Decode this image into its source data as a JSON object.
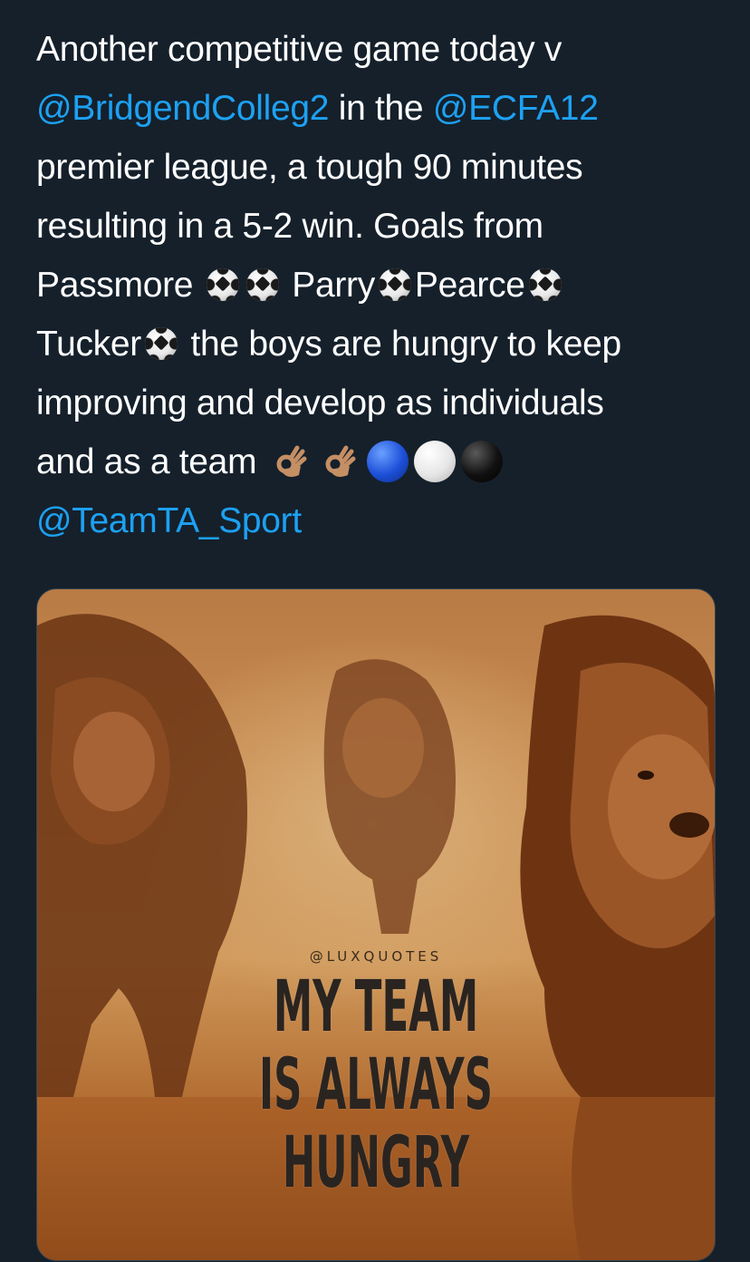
{
  "tweet": {
    "line1": "Another competitive game today v",
    "mention_college": "@BridgendColleg2",
    "in_the": " in the ",
    "mention_ecfa": "@ECFA12",
    "line3": "premier league, a tough 90 minutes",
    "line4": "resulting in a 5-2 win. Goals from",
    "scorer1": "Passmore ",
    "scorer2": " Parry",
    "scorer3": "Pearce",
    "scorer4": "Tucker",
    "line6_rest": "  the boys are hungry to keep",
    "line7": "improving and develop as individuals",
    "line8": "and as a team ",
    "mention_team": "@TeamTA_Sport"
  },
  "emoji": {
    "ball": "soccer-ball-icon",
    "ok_hand": "ok-hand-icon",
    "circles": [
      "blue-circle-icon",
      "white-circle-icon",
      "black-circle-icon"
    ]
  },
  "media": {
    "credit": "@LUXQUOTES",
    "quote_lines": [
      "MY TEAM",
      "IS ALWAYS",
      "HUNGRY"
    ]
  },
  "colors": {
    "background": "#15202b",
    "text": "#ffffff",
    "link": "#1da1f2"
  }
}
